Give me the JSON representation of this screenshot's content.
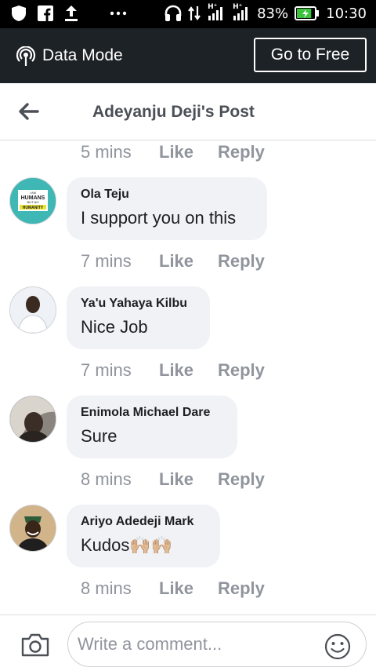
{
  "status_bar": {
    "signal_labels": [
      "H⁺",
      "H⁺"
    ],
    "battery_percent": "83%",
    "battery_level": 0.83,
    "time": "10:30"
  },
  "data_mode": {
    "label": "Data Mode",
    "go_free_label": "Go to Free"
  },
  "header": {
    "title": "Adeyanju Deji's Post"
  },
  "top_actions": {
    "time": "5 mins",
    "like": "Like",
    "reply": "Reply"
  },
  "comments": [
    {
      "author": "Ola Teju",
      "text": "I support you on this",
      "time": "7 mins",
      "like": "Like",
      "reply": "Reply",
      "avatar_text": [
        "I AM",
        "HUMANS",
        "BUT NO",
        "HUMANITY"
      ]
    },
    {
      "author": "Ya'u Yahaya Kilbu",
      "text": "Nice Job",
      "time": "7 mins",
      "like": "Like",
      "reply": "Reply"
    },
    {
      "author": "Enimola Michael Dare",
      "text": "Sure",
      "time": "8 mins",
      "like": "Like",
      "reply": "Reply"
    },
    {
      "author": "Ariyo Adedeji Mark",
      "text": "Kudos🙌🏼🙌🏼",
      "time": "8 mins",
      "like": "Like",
      "reply": "Reply"
    }
  ],
  "composer": {
    "placeholder": "Write a comment..."
  },
  "colors": {
    "status_bar": "#000000",
    "data_bar": "#1d2227",
    "bubble": "#f0f2f5",
    "meta_text": "#90949c",
    "title_text": "#4b4f56"
  }
}
